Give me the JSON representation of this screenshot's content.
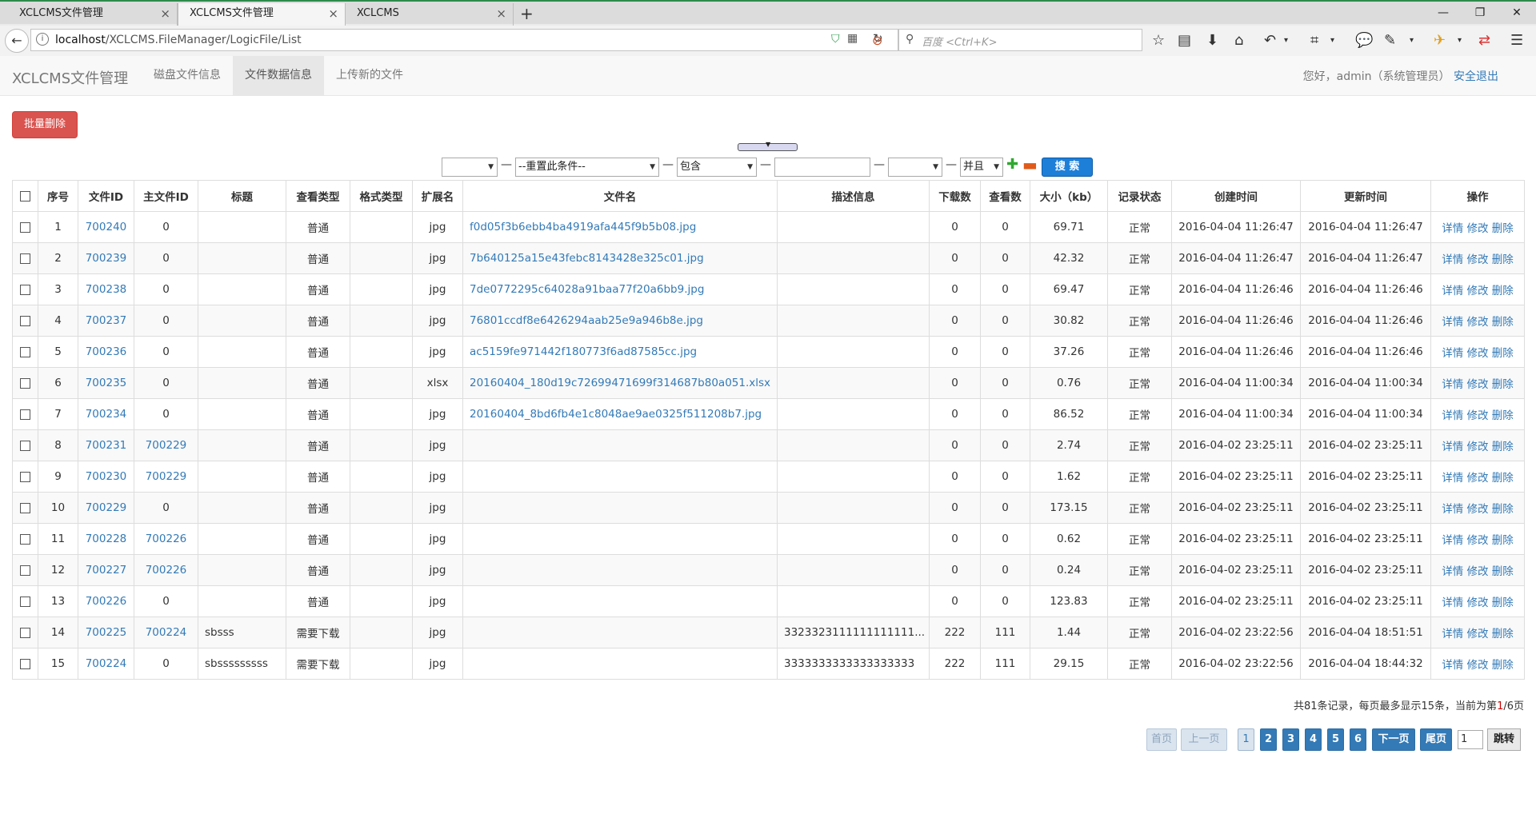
{
  "browser": {
    "tabs": [
      {
        "title": "XCLCMS文件管理",
        "close": "×"
      },
      {
        "title": "XCLCMS文件管理",
        "close": "×"
      },
      {
        "title": "XCLCMS",
        "close": "×"
      }
    ],
    "new_tab": "+",
    "url_host": "localhost",
    "url_path": "/XCLCMS.FileManager/LogicFile/List",
    "search_placeholder": "百度 <Ctrl+K>"
  },
  "app": {
    "brand": "XCLCMS文件管理",
    "nav": [
      "磁盘文件信息",
      "文件数据信息",
      "上传新的文件"
    ],
    "greeting": "您好，admin（系统管理员）",
    "logout": "安全退出"
  },
  "toolbar": {
    "batch_delete": "批量删除"
  },
  "filter": {
    "field_value": "",
    "condition_value": "--重置此条件--",
    "operator_value": "包含",
    "keyword_value": "",
    "extra_value": "",
    "join_value": "并且",
    "search_label": "搜 索"
  },
  "table": {
    "headers": [
      "序号",
      "文件ID",
      "主文件ID",
      "标题",
      "查看类型",
      "格式类型",
      "扩展名",
      "文件名",
      "描述信息",
      "下载数",
      "查看数",
      "大小（kb）",
      "记录状态",
      "创建时间",
      "更新时间",
      "操作"
    ],
    "actions": [
      "详情",
      "修改",
      "删除"
    ],
    "rows": [
      {
        "no": "1",
        "id": "700240",
        "parent": "0",
        "title": "",
        "view": "普通",
        "format": "",
        "ext": "jpg",
        "name": "f0d05f3b6ebb4ba4919afa445f9b5b08.jpg",
        "desc": "",
        "dl": "0",
        "vw": "0",
        "size": "69.71",
        "status": "正常",
        "created": "2016-04-04 11:26:47",
        "updated": "2016-04-04 11:26:47"
      },
      {
        "no": "2",
        "id": "700239",
        "parent": "0",
        "title": "",
        "view": "普通",
        "format": "",
        "ext": "jpg",
        "name": "7b640125a15e43febc8143428e325c01.jpg",
        "desc": "",
        "dl": "0",
        "vw": "0",
        "size": "42.32",
        "status": "正常",
        "created": "2016-04-04 11:26:47",
        "updated": "2016-04-04 11:26:47"
      },
      {
        "no": "3",
        "id": "700238",
        "parent": "0",
        "title": "",
        "view": "普通",
        "format": "",
        "ext": "jpg",
        "name": "7de0772295c64028a91baa77f20a6bb9.jpg",
        "desc": "",
        "dl": "0",
        "vw": "0",
        "size": "69.47",
        "status": "正常",
        "created": "2016-04-04 11:26:46",
        "updated": "2016-04-04 11:26:46"
      },
      {
        "no": "4",
        "id": "700237",
        "parent": "0",
        "title": "",
        "view": "普通",
        "format": "",
        "ext": "jpg",
        "name": "76801ccdf8e6426294aab25e9a946b8e.jpg",
        "desc": "",
        "dl": "0",
        "vw": "0",
        "size": "30.82",
        "status": "正常",
        "created": "2016-04-04 11:26:46",
        "updated": "2016-04-04 11:26:46"
      },
      {
        "no": "5",
        "id": "700236",
        "parent": "0",
        "title": "",
        "view": "普通",
        "format": "",
        "ext": "jpg",
        "name": "ac5159fe971442f180773f6ad87585cc.jpg",
        "desc": "",
        "dl": "0",
        "vw": "0",
        "size": "37.26",
        "status": "正常",
        "created": "2016-04-04 11:26:46",
        "updated": "2016-04-04 11:26:46"
      },
      {
        "no": "6",
        "id": "700235",
        "parent": "0",
        "title": "",
        "view": "普通",
        "format": "",
        "ext": "xlsx",
        "name": "20160404_180d19c72699471699f314687b80a051.xlsx",
        "desc": "",
        "dl": "0",
        "vw": "0",
        "size": "0.76",
        "status": "正常",
        "created": "2016-04-04 11:00:34",
        "updated": "2016-04-04 11:00:34"
      },
      {
        "no": "7",
        "id": "700234",
        "parent": "0",
        "title": "",
        "view": "普通",
        "format": "",
        "ext": "jpg",
        "name": "20160404_8bd6fb4e1c8048ae9ae0325f511208b7.jpg",
        "desc": "",
        "dl": "0",
        "vw": "0",
        "size": "86.52",
        "status": "正常",
        "created": "2016-04-04 11:00:34",
        "updated": "2016-04-04 11:00:34"
      },
      {
        "no": "8",
        "id": "700231",
        "parent": "700229",
        "title": "",
        "view": "普通",
        "format": "",
        "ext": "jpg",
        "name": "",
        "desc": "",
        "dl": "0",
        "vw": "0",
        "size": "2.74",
        "status": "正常",
        "created": "2016-04-02 23:25:11",
        "updated": "2016-04-02 23:25:11"
      },
      {
        "no": "9",
        "id": "700230",
        "parent": "700229",
        "title": "",
        "view": "普通",
        "format": "",
        "ext": "jpg",
        "name": "",
        "desc": "",
        "dl": "0",
        "vw": "0",
        "size": "1.62",
        "status": "正常",
        "created": "2016-04-02 23:25:11",
        "updated": "2016-04-02 23:25:11"
      },
      {
        "no": "10",
        "id": "700229",
        "parent": "0",
        "title": "",
        "view": "普通",
        "format": "",
        "ext": "jpg",
        "name": "",
        "desc": "",
        "dl": "0",
        "vw": "0",
        "size": "173.15",
        "status": "正常",
        "created": "2016-04-02 23:25:11",
        "updated": "2016-04-02 23:25:11"
      },
      {
        "no": "11",
        "id": "700228",
        "parent": "700226",
        "title": "",
        "view": "普通",
        "format": "",
        "ext": "jpg",
        "name": "",
        "desc": "",
        "dl": "0",
        "vw": "0",
        "size": "0.62",
        "status": "正常",
        "created": "2016-04-02 23:25:11",
        "updated": "2016-04-02 23:25:11"
      },
      {
        "no": "12",
        "id": "700227",
        "parent": "700226",
        "title": "",
        "view": "普通",
        "format": "",
        "ext": "jpg",
        "name": "",
        "desc": "",
        "dl": "0",
        "vw": "0",
        "size": "0.24",
        "status": "正常",
        "created": "2016-04-02 23:25:11",
        "updated": "2016-04-02 23:25:11"
      },
      {
        "no": "13",
        "id": "700226",
        "parent": "0",
        "title": "",
        "view": "普通",
        "format": "",
        "ext": "jpg",
        "name": "",
        "desc": "",
        "dl": "0",
        "vw": "0",
        "size": "123.83",
        "status": "正常",
        "created": "2016-04-02 23:25:11",
        "updated": "2016-04-02 23:25:11"
      },
      {
        "no": "14",
        "id": "700225",
        "parent": "700224",
        "title": "sbsss",
        "view": "需要下载",
        "format": "",
        "ext": "jpg",
        "name": "",
        "desc": "3323323111111111111...",
        "dl": "222",
        "vw": "111",
        "size": "1.44",
        "status": "正常",
        "created": "2016-04-02 23:22:56",
        "updated": "2016-04-04 18:51:51"
      },
      {
        "no": "15",
        "id": "700224",
        "parent": "0",
        "title": "sbsssssssss",
        "view": "需要下载",
        "format": "",
        "ext": "jpg",
        "name": "",
        "desc": "3333333333333333333",
        "dl": "222",
        "vw": "111",
        "size": "29.15",
        "status": "正常",
        "created": "2016-04-02 23:22:56",
        "updated": "2016-04-04 18:44:32"
      }
    ]
  },
  "pager": {
    "info_prefix": "共81条记录，每页最多显示15条，当前为第",
    "current": "1",
    "info_suffix": "/6页",
    "first": "首页",
    "prev": "上一页",
    "pages": [
      "1",
      "2",
      "3",
      "4",
      "5",
      "6"
    ],
    "next": "下一页",
    "last": "尾页",
    "jump_value": "1",
    "jump": "跳转"
  }
}
